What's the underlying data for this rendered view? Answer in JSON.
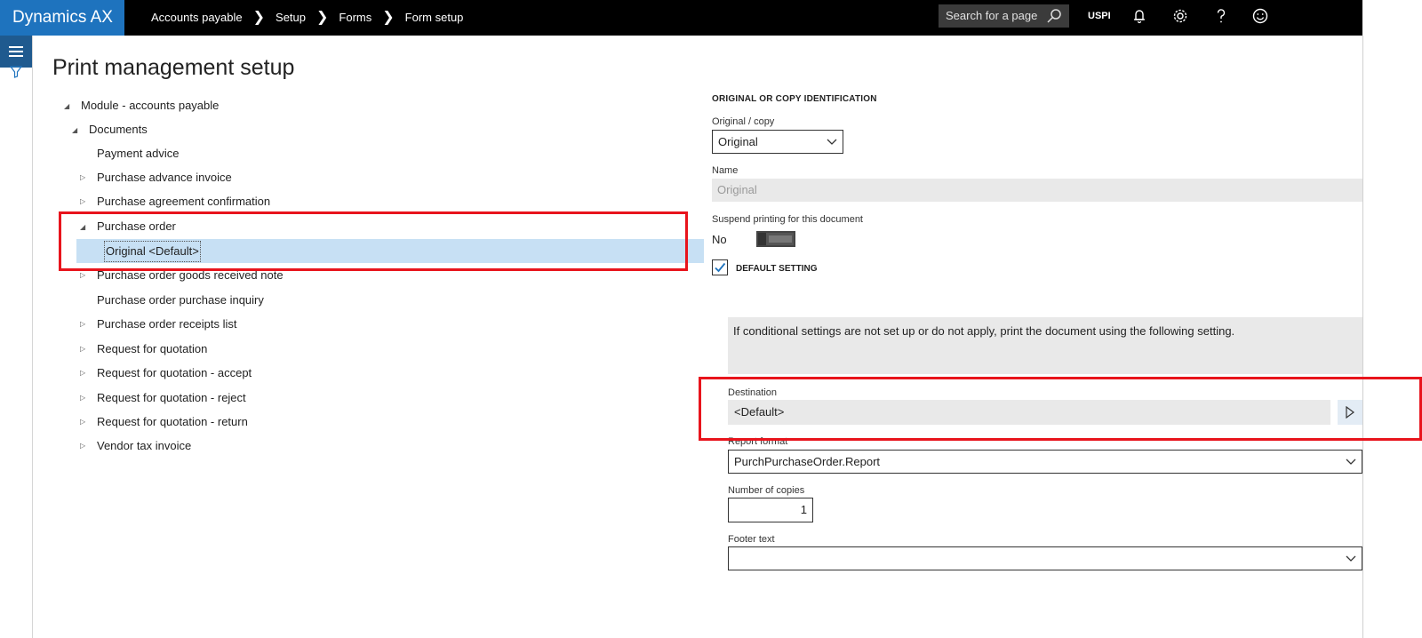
{
  "app": {
    "name": "Dynamics AX"
  },
  "breadcrumbs": [
    "Accounts payable",
    "Setup",
    "Forms",
    "Form setup"
  ],
  "search": {
    "placeholder": "Search for a page"
  },
  "company": "USPI",
  "page": {
    "title": "Print management setup"
  },
  "tree": {
    "items": [
      {
        "label": "Module - accounts payable",
        "level": 0,
        "expander": "expanded"
      },
      {
        "label": "Documents",
        "level": 1,
        "expander": "expanded"
      },
      {
        "label": "Payment advice",
        "level": 2,
        "expander": "none"
      },
      {
        "label": "Purchase advance invoice",
        "level": 2,
        "expander": "collapsed"
      },
      {
        "label": "Purchase agreement confirmation",
        "level": 2,
        "expander": "collapsed"
      },
      {
        "label": "Purchase order",
        "level": 2,
        "expander": "expanded"
      },
      {
        "label": "Original <Default>",
        "level": 3,
        "expander": "none",
        "selected": true
      },
      {
        "label": "Purchase order goods received note",
        "level": 2,
        "expander": "collapsed"
      },
      {
        "label": "Purchase order purchase inquiry",
        "level": 2,
        "expander": "none"
      },
      {
        "label": "Purchase order receipts list",
        "level": 2,
        "expander": "collapsed"
      },
      {
        "label": "Request for quotation",
        "level": 2,
        "expander": "collapsed"
      },
      {
        "label": "Request for quotation - accept",
        "level": 2,
        "expander": "collapsed"
      },
      {
        "label": "Request for quotation - reject",
        "level": 2,
        "expander": "collapsed"
      },
      {
        "label": "Request for quotation - return",
        "level": 2,
        "expander": "collapsed"
      },
      {
        "label": "Vendor tax invoice",
        "level": 2,
        "expander": "collapsed"
      }
    ]
  },
  "details": {
    "section_header": "ORIGINAL OR COPY IDENTIFICATION",
    "original_copy": {
      "label": "Original / copy",
      "value": "Original"
    },
    "name": {
      "label": "Name",
      "value": "Original"
    },
    "suspend": {
      "label": "Suspend printing for this document",
      "value": "No"
    },
    "default_setting": {
      "label": "DEFAULT SETTING",
      "checked": true
    },
    "info": "If conditional settings are not set up or do not apply, print the document using the following setting.",
    "destination": {
      "label": "Destination",
      "value": "<Default>"
    },
    "report_format": {
      "label": "Report format",
      "value": "PurchPurchaseOrder.Report"
    },
    "copies": {
      "label": "Number of copies",
      "value": "1"
    },
    "footer": {
      "label": "Footer text",
      "value": ""
    }
  },
  "colors": {
    "brand": "#1e73be",
    "topbar": "#000000",
    "selection": "#c7e0f4",
    "annotation": "#e8141c"
  }
}
